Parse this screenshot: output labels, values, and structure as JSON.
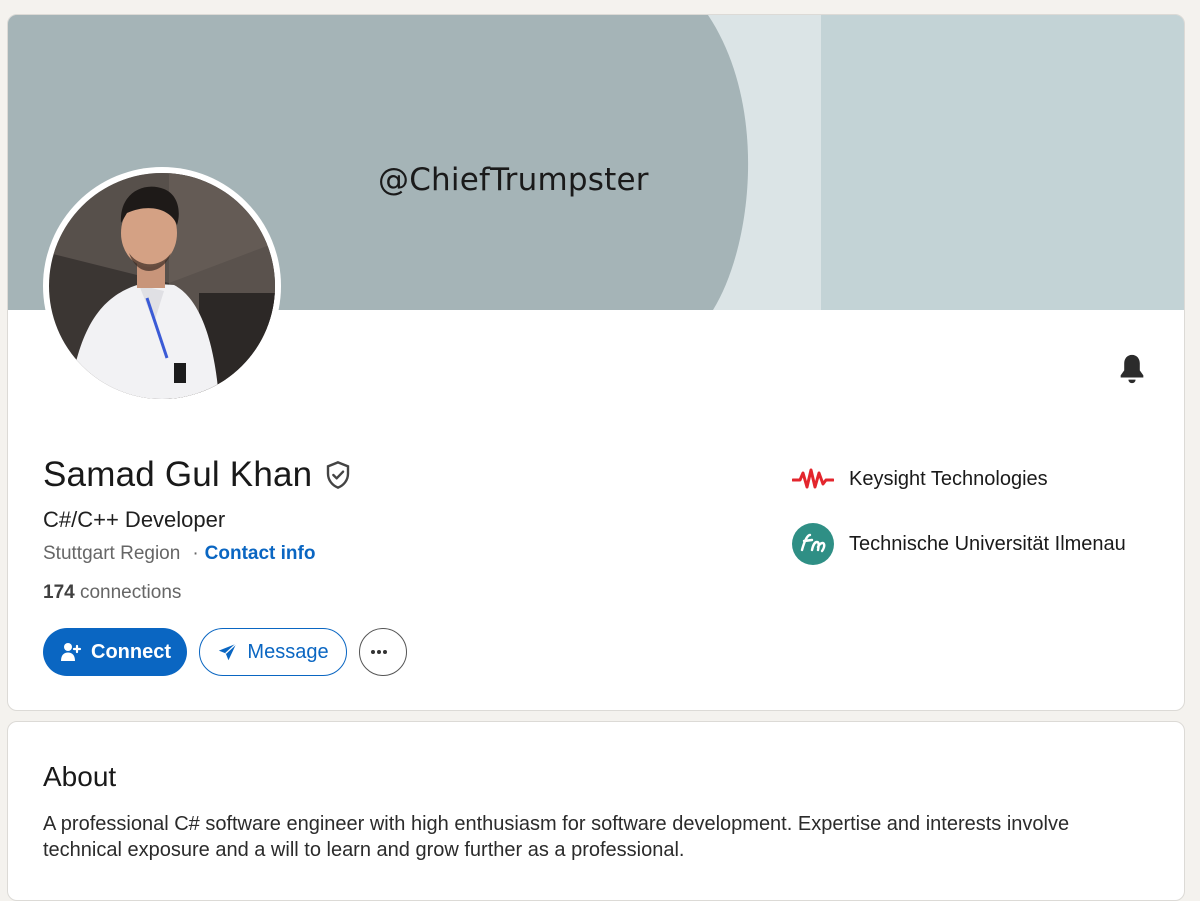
{
  "banner": {
    "handle": "@ChiefTrumpster",
    "colors": {
      "left": "#a5b4b7",
      "stripe": "#dbe4e6",
      "right": "#c3d3d6"
    }
  },
  "profile": {
    "name": "Samad Gul Khan",
    "headline": "C#/C++ Developer",
    "location": "Stuttgart Region",
    "separator": "·",
    "contact_info": "Contact info",
    "connections_count": "174",
    "connections_label": "connections"
  },
  "actions": {
    "connect_label": "Connect",
    "message_label": "Message",
    "more_label": "More actions"
  },
  "organizations": [
    {
      "name": "Keysight Technologies",
      "logo": "keysight-logo",
      "color": "#e3262d"
    },
    {
      "name": "Technische Universität Ilmenau",
      "logo": "tu-ilmenau-logo",
      "color": "#2f8f85"
    }
  ],
  "about": {
    "title": "About",
    "text": "A professional C# software engineer with high enthusiasm for software development. Expertise and interests involve technical exposure and a will to learn and grow further as a professional."
  },
  "icons": {
    "verified": "verified-shield-icon",
    "bell": "bell-icon",
    "connect": "add-person-icon",
    "message": "send-icon",
    "more": "ellipsis-icon"
  },
  "theme": {
    "accent": "#0a66c2",
    "background": "#f4f2ee"
  }
}
